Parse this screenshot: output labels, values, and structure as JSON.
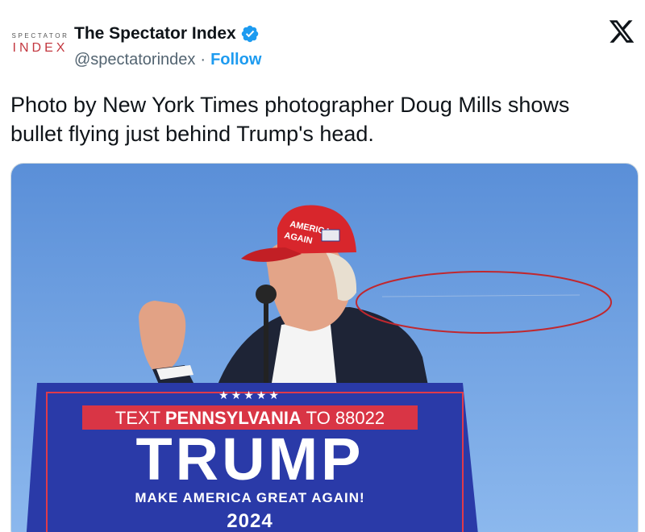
{
  "author": {
    "display_name": "The Spectator Index",
    "handle": "@spectatorindex",
    "separator": "·",
    "follow_label": "Follow",
    "avatar_text_top": "SPECTATOR",
    "avatar_text_bottom": "INDEX",
    "verified_icon": "verified-badge-icon",
    "verified_color": "#1d9bf0"
  },
  "platform": {
    "logo_icon": "x-logo-icon"
  },
  "tweet": {
    "text": "Photo by New York Times photographer Doug Mills shows\nbullet flying just behind Trump's head."
  },
  "photo": {
    "podium_top_text_prefix": "TEXT ",
    "podium_top_text_state": "PENNSYLVANIA",
    "podium_top_text_suffix": " TO 88022",
    "podium_stars": "★★★★★",
    "podium_main": "TRUMP",
    "podium_slogan": "MAKE AMERICA GREAT AGAIN!",
    "podium_year": "2024",
    "hat_text_1": "AMERICA",
    "hat_text_2": "AGAIN",
    "annotation_color": "#c0282f",
    "sky_color": "#6a9ee0"
  }
}
